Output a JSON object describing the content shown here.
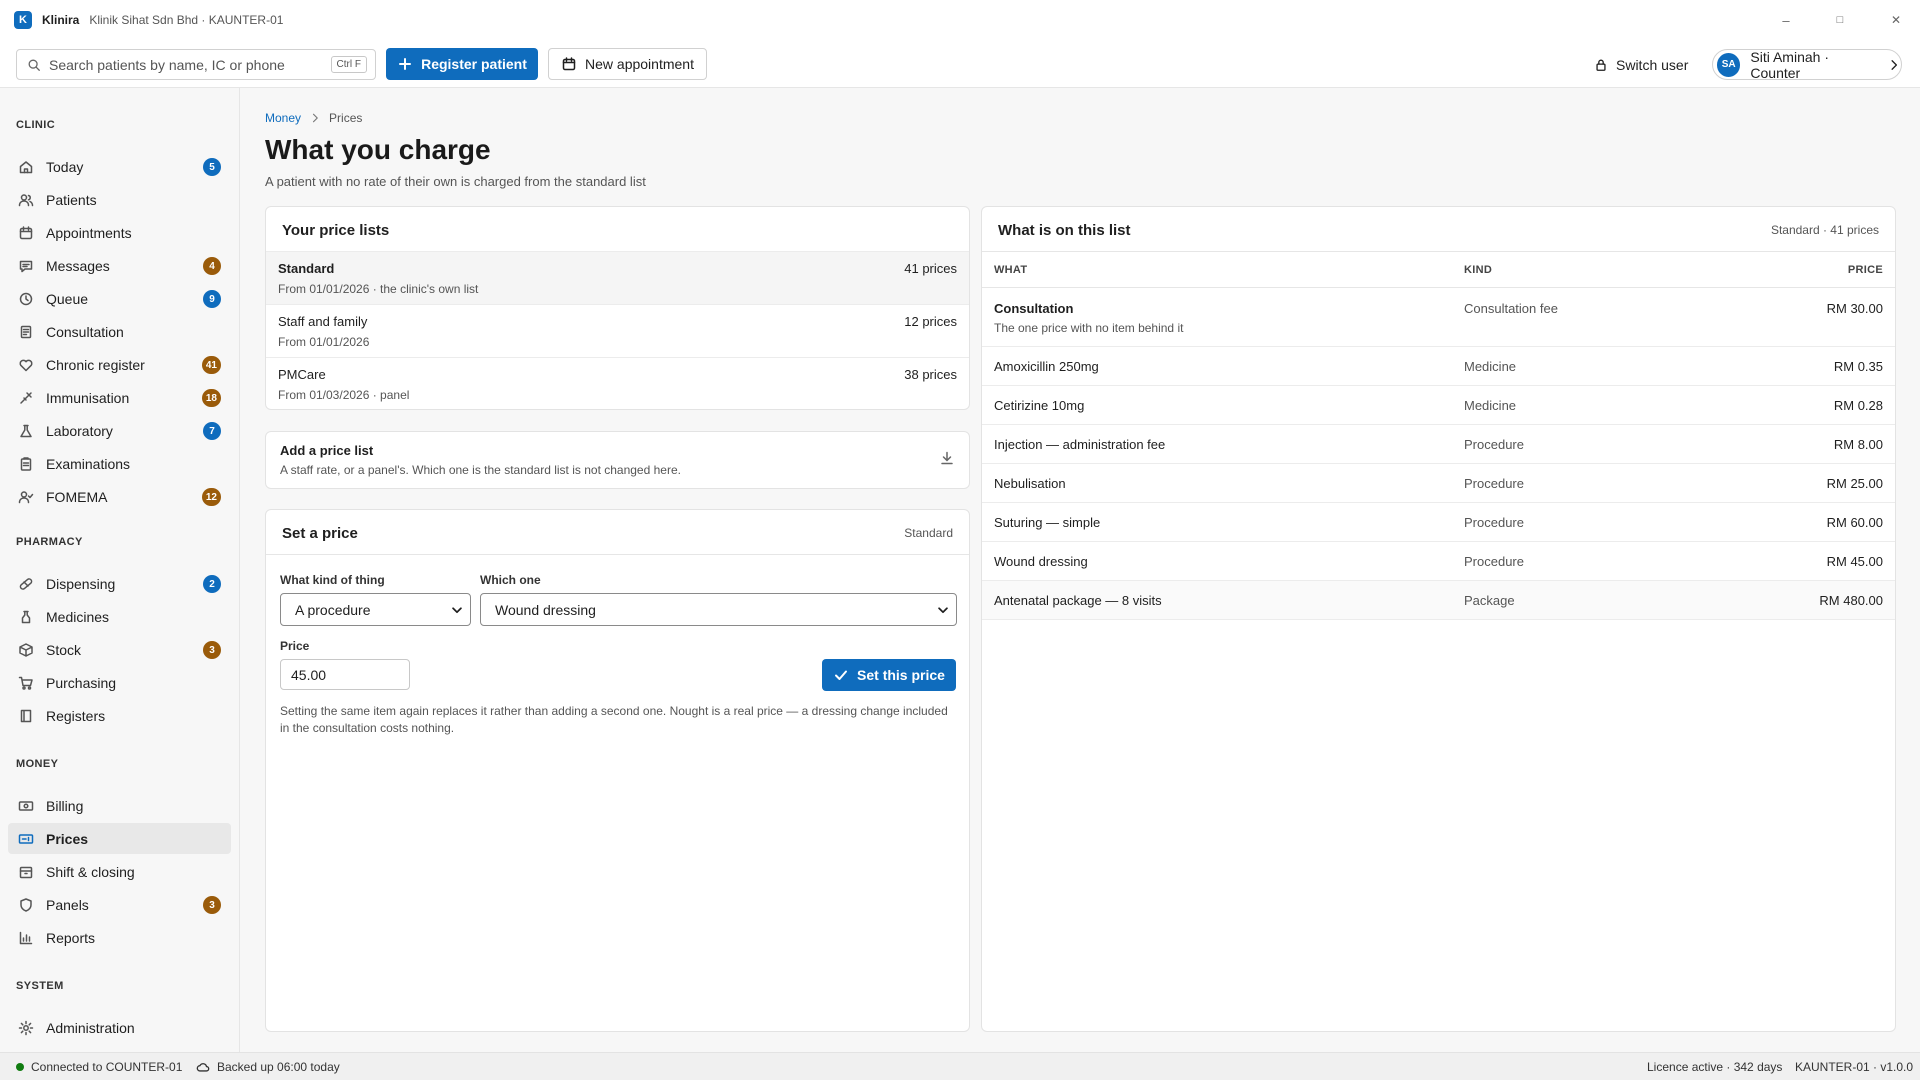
{
  "app": {
    "logo_letter": "K",
    "name": "Klinira",
    "subtitle": "Klinik Sihat Sdn Bhd · KAUNTER-01"
  },
  "window": {
    "minimize": "–",
    "maximize": "□",
    "close": "✕"
  },
  "toolbar": {
    "search_placeholder": "Search patients by name, IC or phone",
    "search_shortcut": "Ctrl F",
    "register_label": "Register patient",
    "appointment_label": "New appointment",
    "switch_user_label": "Switch user",
    "user_initials": "SA",
    "user_name": "Siti Aminah · Counter"
  },
  "sidebar": {
    "sections": {
      "clinic": "CLINIC",
      "pharmacy": "PHARMACY",
      "money": "MONEY",
      "system": "SYSTEM"
    },
    "items": [
      {
        "label": "Today",
        "icon": "home-icon",
        "badge": "5",
        "badge_color": "#0f6cbd"
      },
      {
        "label": "Patients",
        "icon": "people-icon",
        "badge": null
      },
      {
        "label": "Appointments",
        "icon": "calendar-icon",
        "badge": null
      },
      {
        "label": "Messages",
        "icon": "chat-icon",
        "badge": "4",
        "badge_color": "#9a5b0a"
      },
      {
        "label": "Queue",
        "icon": "clock-icon",
        "badge": "9",
        "badge_color": "#0f6cbd"
      },
      {
        "label": "Consultation",
        "icon": "document-icon",
        "badge": null
      },
      {
        "label": "Chronic register",
        "icon": "heart-icon",
        "badge": "41",
        "badge_color": "#9a5b0a"
      },
      {
        "label": "Immunisation",
        "icon": "syringe-icon",
        "badge": "18",
        "badge_color": "#9a5b0a"
      },
      {
        "label": "Laboratory",
        "icon": "flask-icon",
        "badge": "7",
        "badge_color": "#0f6cbd"
      },
      {
        "label": "Examinations",
        "icon": "clipboard-icon",
        "badge": null
      },
      {
        "label": "FOMEMA",
        "icon": "person-check-icon",
        "badge": "12",
        "badge_color": "#9a5b0a"
      },
      {
        "label": "Dispensing",
        "icon": "pill-icon",
        "badge": "2",
        "badge_color": "#0f6cbd"
      },
      {
        "label": "Medicines",
        "icon": "bottle-icon",
        "badge": null
      },
      {
        "label": "Stock",
        "icon": "box-icon",
        "badge": "3",
        "badge_color": "#9a5b0a"
      },
      {
        "label": "Purchasing",
        "icon": "cart-icon",
        "badge": null
      },
      {
        "label": "Registers",
        "icon": "book-icon",
        "badge": null
      },
      {
        "label": "Billing",
        "icon": "money-icon",
        "badge": null
      },
      {
        "label": "Prices",
        "icon": "price-tag-icon",
        "badge": null,
        "active": true
      },
      {
        "label": "Shift & closing",
        "icon": "lock-box-icon",
        "badge": null
      },
      {
        "label": "Panels",
        "icon": "shield-icon",
        "badge": "3",
        "badge_color": "#9a5b0a"
      },
      {
        "label": "Reports",
        "icon": "bar-chart-icon",
        "badge": null
      },
      {
        "label": "Administration",
        "icon": "gear-icon",
        "badge": null
      }
    ]
  },
  "breadcrumb": {
    "parent": "Money",
    "current": "Prices"
  },
  "page": {
    "title": "What you charge",
    "subtitle": "A patient with no rate of their own is charged from the standard list"
  },
  "price_lists": {
    "title": "Your price lists",
    "rows": [
      {
        "name": "Standard",
        "from": "From 01/01/2026 · the clinic's own list",
        "count": "41 prices",
        "selected": true
      },
      {
        "name": "Staff and family",
        "from": "From 01/01/2026",
        "count": "12 prices"
      },
      {
        "name": "PMCare",
        "from": "From 01/03/2026 · panel",
        "count": "38 prices"
      }
    ]
  },
  "add_list": {
    "title": "Add a price list",
    "description": "A staff rate, or a panel's. Which one is the standard list is not changed here."
  },
  "set_price": {
    "title": "Set a price",
    "list_name": "Standard",
    "kind_label": "What kind of thing",
    "kind_value": "A procedure",
    "which_label": "Which one",
    "which_value": "Wound dressing",
    "price_label": "Price",
    "price_value": "45.00",
    "submit_label": "Set this price",
    "help": "Setting the same item again replaces it rather than adding a second one. Nought is a real price — a dressing change included in the consultation costs nothing."
  },
  "list_items": {
    "title": "What is on this list",
    "meta": "Standard · 41 prices",
    "columns": {
      "what": "WHAT",
      "kind": "KIND",
      "price": "PRICE"
    },
    "rows": [
      {
        "what": "Consultation",
        "note": "The one price with no item behind it",
        "kind": "Consultation fee",
        "price": "RM 30.00"
      },
      {
        "what": "Amoxicillin 250mg",
        "kind": "Medicine",
        "price": "RM 0.35"
      },
      {
        "what": "Cetirizine 10mg",
        "kind": "Medicine",
        "price": "RM 0.28"
      },
      {
        "what": "Injection — administration fee",
        "kind": "Procedure",
        "price": "RM 8.00"
      },
      {
        "what": "Nebulisation",
        "kind": "Procedure",
        "price": "RM 25.00"
      },
      {
        "what": "Suturing — simple",
        "kind": "Procedure",
        "price": "RM 60.00"
      },
      {
        "what": "Wound dressing",
        "kind": "Procedure",
        "price": "RM 45.00"
      },
      {
        "what": "Antenatal package — 8 visits",
        "kind": "Package",
        "price": "RM 480.00"
      }
    ]
  },
  "status": {
    "connection": "Connected to COUNTER-01",
    "backup": "Backed up 06:00 today",
    "licence": "Licence active · 342 days",
    "version": "KAUNTER-01 · v1.0.0"
  },
  "colors": {
    "accent": "#0f6cbd",
    "badge_amber": "#9a5b0a",
    "online": "#107c10"
  }
}
